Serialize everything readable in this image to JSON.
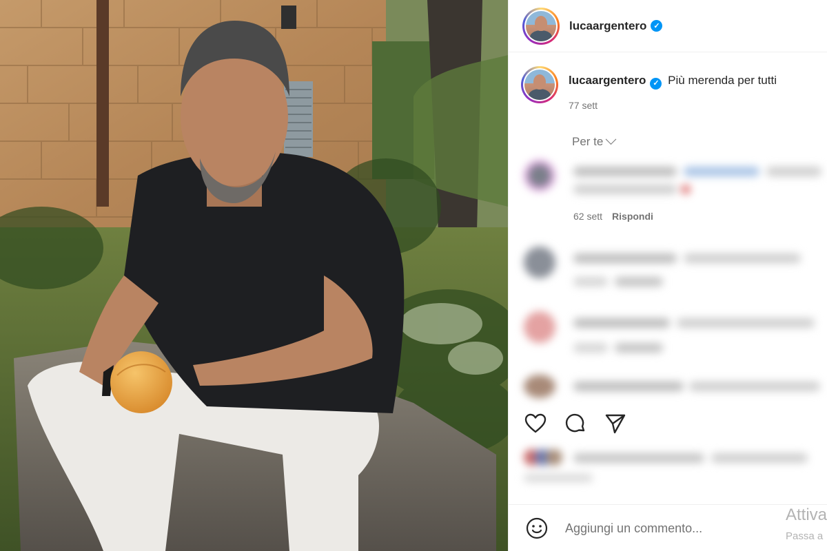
{
  "post": {
    "username": "lucaargentero",
    "verified_icon": "verified-badge-icon",
    "caption": "Più merenda per tutti",
    "caption_time": "77 sett"
  },
  "comments_filter": {
    "label": "Per te",
    "icon": "chevron-down-icon"
  },
  "comments": [
    {
      "time": "62 sett",
      "reply_label": "Rispondi",
      "blurred": false
    },
    {
      "time": "",
      "reply_label": "Rispondi",
      "blurred": true
    },
    {
      "time": "",
      "reply_label": "Rispondi",
      "blurred": true
    }
  ],
  "actions": {
    "like_icon": "heart-icon",
    "comment_icon": "comment-bubble-icon",
    "share_icon": "paper-plane-icon"
  },
  "composer": {
    "placeholder": "Aggiungi un commento...",
    "emoji_icon": "emoji-smiley-icon"
  },
  "windows_watermark": {
    "line1": "Attiva",
    "line2": "Passa a"
  },
  "colors": {
    "verified": "#0095f6",
    "text": "#262626",
    "muted": "#737373",
    "border": "#efefef"
  }
}
